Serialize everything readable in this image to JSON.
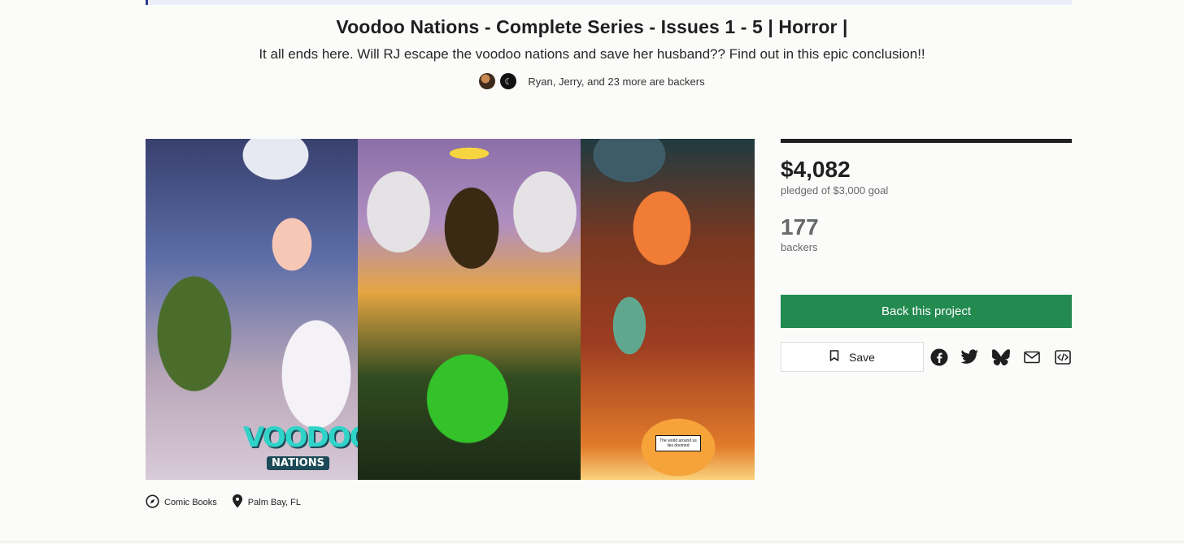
{
  "project": {
    "title": "Voodoo Nations - Complete Series - Issues 1 - 5 | Horror |",
    "blurb": "It all ends here. Will RJ escape the voodoo nations and save her husband?? Find out in this epic conclusion!!",
    "backers_summary": "Ryan, Jerry, and 23 more are backers"
  },
  "hero": {
    "logo_line1": "VOODOO",
    "logo_line2": "NATIONS",
    "speech_bubble": "The world around us lies doomed"
  },
  "stats": {
    "pledged": "$4,082",
    "pledged_goal": "pledged of $3,000 goal",
    "backers": "177",
    "backers_label": "backers"
  },
  "actions": {
    "back_label": "Back this project",
    "save_label": "Save",
    "share_icons": [
      "facebook-icon",
      "twitter-icon",
      "bluesky-icon",
      "email-icon",
      "embed-icon"
    ]
  },
  "meta": {
    "category": "Comic Books",
    "location": "Palm Bay, FL"
  },
  "colors": {
    "accent_green": "#238a50",
    "banner_border": "#2d3a8c",
    "muted_text": "#656969"
  }
}
